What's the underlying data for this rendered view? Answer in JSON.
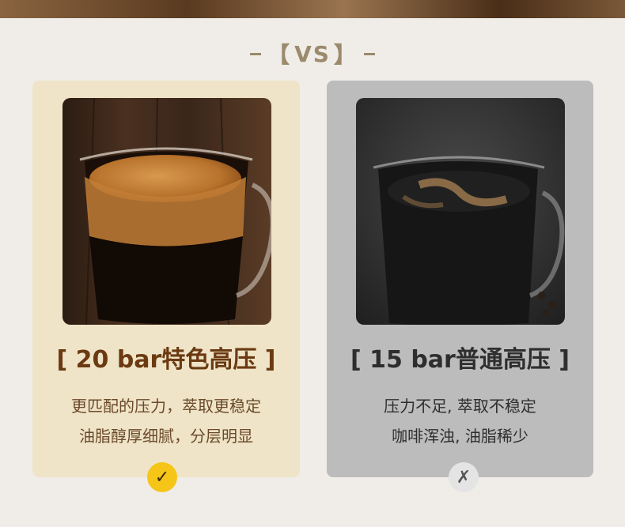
{
  "heading": {
    "vs_text": "VS",
    "left_bracket": "【",
    "right_bracket": "】"
  },
  "left_card": {
    "title": "[ 20 bar特色高压 ]",
    "desc_line1": "更匹配的压力，萃取更稳定",
    "desc_line2": "油脂醇厚细腻，分层明显",
    "badge": "✓",
    "icon": "espresso-crema-photo",
    "accent_color": "#f5c518"
  },
  "right_card": {
    "title": "[ 15 bar普通高压 ]",
    "desc_line1": "压力不足, 萃取不稳定",
    "desc_line2": "咖啡浑浊, 油脂稀少",
    "badge": "✗",
    "icon": "thin-coffee-photo"
  }
}
